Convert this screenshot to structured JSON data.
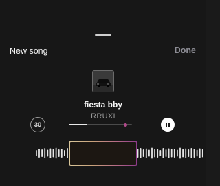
{
  "header": {
    "title": "New song",
    "done_label": "Done"
  },
  "song": {
    "title": "fiesta bby",
    "artist": "RRUXI"
  },
  "controls": {
    "duration_label": "30",
    "progress": 0.48,
    "playback_state": "playing"
  },
  "icons": {
    "duration": "timer-30-icon",
    "pause": "pause-icon",
    "artwork": "car-artwork-icon"
  },
  "colors": {
    "background": "#171717",
    "done": "#8d8d95",
    "selection_gradient_start": "#d9c79b",
    "selection_gradient_end": "#8c3a8a",
    "progress_knob": "#b04a8a"
  }
}
